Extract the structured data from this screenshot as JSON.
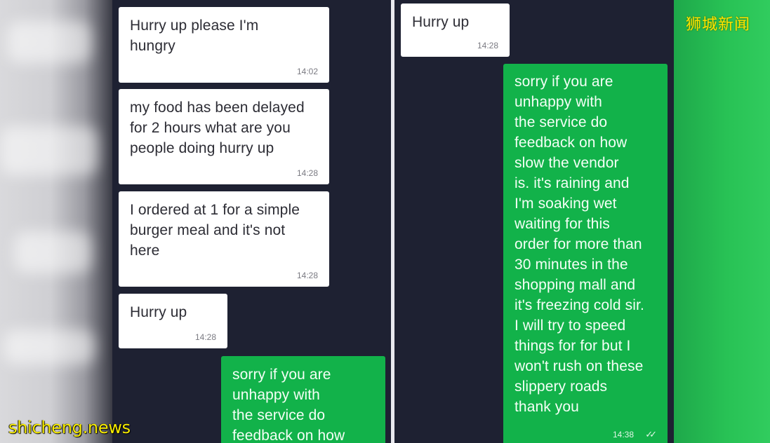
{
  "watermarks": {
    "top_right": "狮城新闻",
    "bottom_left": "shicheng.news"
  },
  "colors": {
    "panel_bg": "#1e2132",
    "incoming_bubble": "#ffffff",
    "outgoing_bubble": "#12b24a"
  },
  "left_chat": {
    "messages": [
      {
        "text": "Hurry up please I'm\nhungry",
        "time": "14:02",
        "direction": "incoming"
      },
      {
        "text": "my food has been delayed\nfor 2 hours what are you\npeople doing hurry up",
        "time": "14:28",
        "direction": "incoming"
      },
      {
        "text": "I ordered at 1 for a simple\nburger meal and it's not\nhere",
        "time": "14:28",
        "direction": "incoming"
      },
      {
        "text": "Hurry up",
        "time": "14:28",
        "direction": "incoming"
      },
      {
        "text": "sorry if you are\nunhappy with\nthe service do\nfeedback on how",
        "time": "",
        "direction": "outgoing"
      }
    ]
  },
  "right_chat": {
    "messages": [
      {
        "text": "Hurry up",
        "time": "14:28",
        "direction": "incoming"
      },
      {
        "text": "sorry if you are\nunhappy with\nthe service do\nfeedback on how\nslow the vendor\nis. it's raining and\nI'm soaking wet\nwaiting for this\norder for more than\n30 minutes in the\nshopping mall and\nit's freezing cold sir.\nI will try to speed\nthings for for but I\nwon't rush on these\nslippery roads\nthank you",
        "time": "14:38",
        "ticks": "✓✓",
        "direction": "outgoing"
      }
    ]
  }
}
